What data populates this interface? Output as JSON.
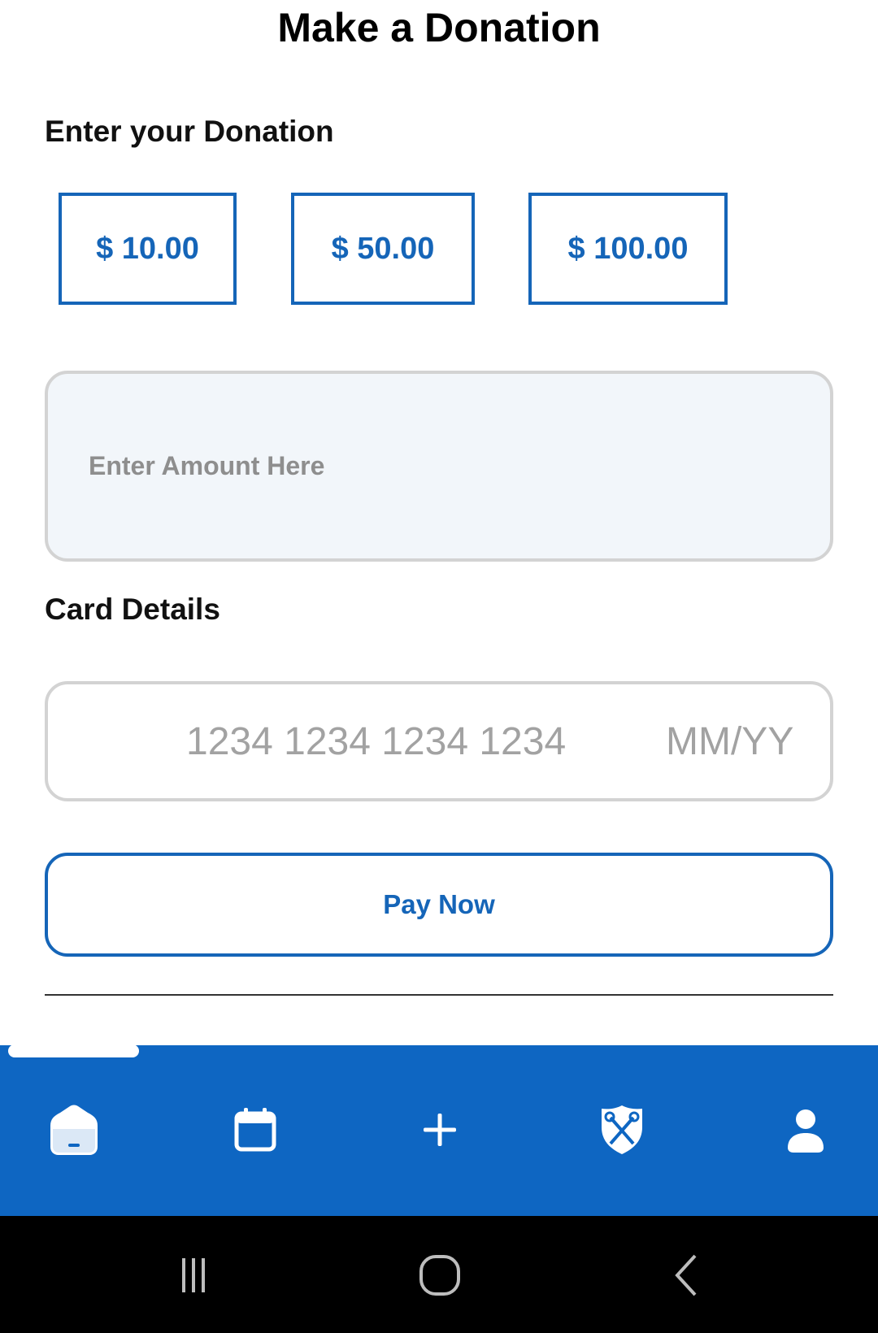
{
  "header": {
    "title": "Make a Donation"
  },
  "donation": {
    "heading": "Enter your Donation",
    "presets": [
      "$ 10.00",
      "$ 50.00",
      "$ 100.00"
    ],
    "amount_value": "",
    "amount_placeholder": "Enter Amount Here"
  },
  "card": {
    "heading": "Card Details",
    "number_value": "",
    "number_placeholder": "1234 1234 1234 1234",
    "expiry_value": "",
    "expiry_placeholder": "MM/YY"
  },
  "actions": {
    "pay_label": "Pay Now"
  },
  "bottom_nav": {
    "active_index": 0,
    "items": [
      {
        "icon": "home-icon"
      },
      {
        "icon": "calendar-icon"
      },
      {
        "icon": "plus-icon"
      },
      {
        "icon": "shield-icon"
      },
      {
        "icon": "profile-icon"
      }
    ]
  },
  "system_nav": {
    "items": [
      {
        "icon": "recent-apps-icon"
      },
      {
        "icon": "home-circle-icon"
      },
      {
        "icon": "back-icon"
      }
    ]
  },
  "colors": {
    "accent": "#1565b8",
    "nav_bar": "#0e66c2",
    "input_bg": "#f2f6fa",
    "border_gray": "#d3d3d3"
  }
}
